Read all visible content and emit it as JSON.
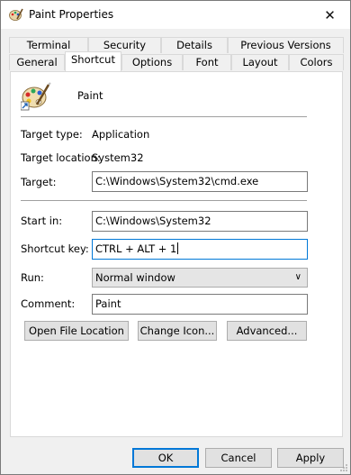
{
  "window": {
    "title": "Paint Properties"
  },
  "tabs_row1": [
    "Terminal",
    "Security",
    "Details",
    "Previous Versions"
  ],
  "tabs_row2": [
    "General",
    "Shortcut",
    "Options",
    "Font",
    "Layout",
    "Colors"
  ],
  "active_tab": "Shortcut",
  "app": {
    "name": "Paint",
    "icon": "paint-palette-icon"
  },
  "fields": {
    "target_type_label": "Target type:",
    "target_type_value": "Application",
    "target_location_label": "Target location:",
    "target_location_value": "System32",
    "target_label": "Target:",
    "target_value": "C:\\Windows\\System32\\cmd.exe",
    "start_in_label": "Start in:",
    "start_in_value": "C:\\Windows\\System32",
    "shortcut_key_label": "Shortcut key:",
    "shortcut_key_value": "CTRL + ALT + 1",
    "run_label": "Run:",
    "run_value": "Normal window",
    "comment_label": "Comment:",
    "comment_value": "Paint"
  },
  "buttons": {
    "open_file_location": "Open File Location",
    "change_icon": "Change Icon...",
    "advanced": "Advanced...",
    "ok": "OK",
    "cancel": "Cancel",
    "apply": "Apply"
  },
  "colors": {
    "focus_accent": "#0078d7",
    "panel": "#ffffff",
    "chrome": "#f0f0f0"
  }
}
